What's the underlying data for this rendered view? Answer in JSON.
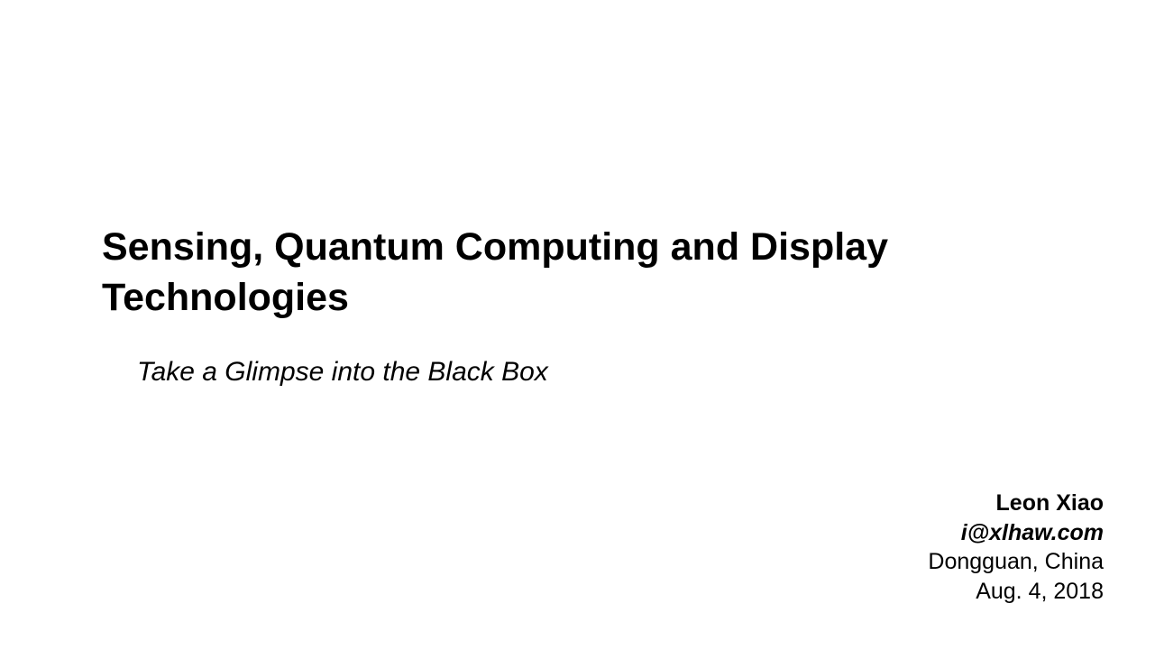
{
  "slide": {
    "title_line1": "Sensing, Quantum Computing and Display",
    "title_line2": "Technologies",
    "subtitle": "Take a Glimpse into the Black Box",
    "author": {
      "name": "Leon Xiao",
      "email": "i@xlhaw.com",
      "location": "Dongguan, China",
      "date": "Aug. 4, 2018"
    }
  }
}
